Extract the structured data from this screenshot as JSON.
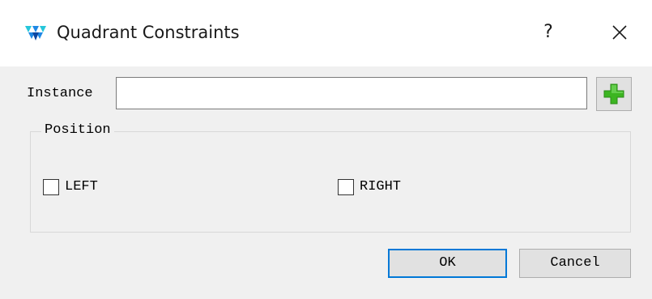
{
  "window": {
    "title": "Quadrant Constraints",
    "help_label": "?",
    "app_icon": "gowin-logo-icon",
    "close_icon": "close-icon"
  },
  "instance": {
    "label": "Instance",
    "value": "",
    "add_icon": "green-plus-icon"
  },
  "position_group": {
    "label": "Position",
    "options": [
      {
        "label": "LEFT",
        "checked": false
      },
      {
        "label": "RIGHT",
        "checked": false
      }
    ]
  },
  "buttons": {
    "ok_label": "OK",
    "cancel_label": "Cancel"
  },
  "colors": {
    "focus_border": "#0078d7",
    "plus_green": "#3cb521",
    "logo_blue": "#1e88e5",
    "logo_cyan": "#26c6da"
  }
}
